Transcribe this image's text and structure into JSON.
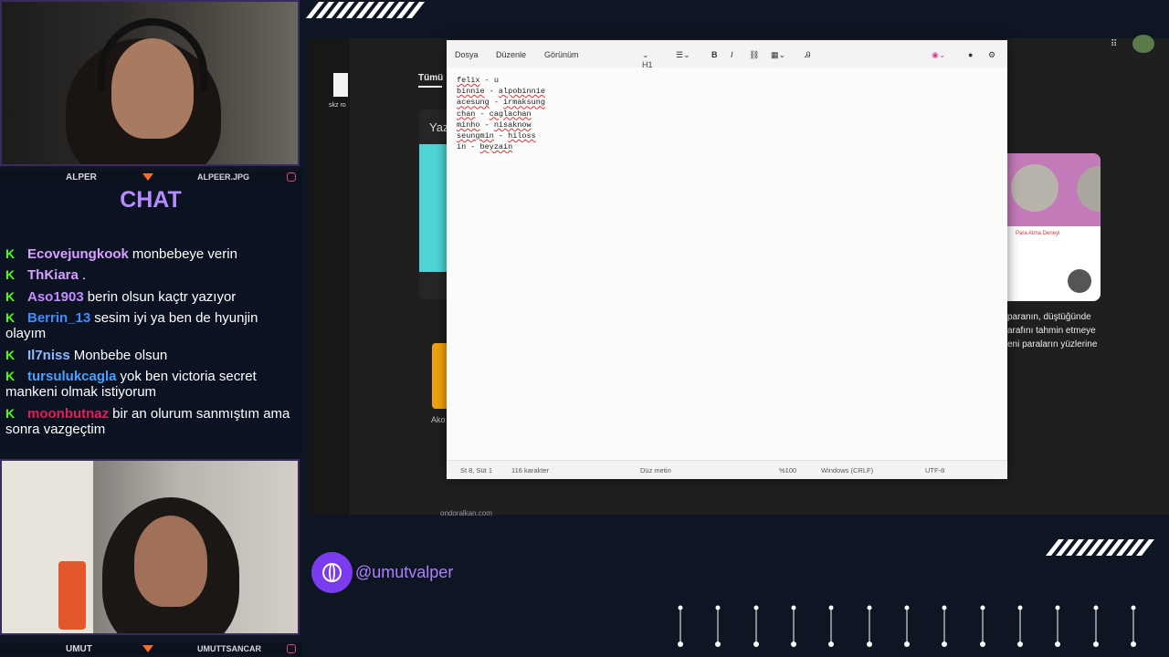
{
  "cams": {
    "top_left_label": "ALPER",
    "top_right_label": "ALPEER.JPG",
    "bottom_left_label": "UMUT",
    "bottom_right_label": "UMUTTSANCAR"
  },
  "chat": {
    "title": "CHAT",
    "messages": [
      {
        "user": "Ecovejungkook",
        "text": "monbebeye verin",
        "color": "#d8a0ff"
      },
      {
        "user": "ThKiara",
        "text": ".",
        "color": "#d8a0ff"
      },
      {
        "user": "Aso1903",
        "text": "berin olsun kaçtr yazıyor",
        "color": "#c58cff"
      },
      {
        "user": "Berrin_13",
        "text": "sesim iyi ya ben de hyunjin olayım",
        "color": "#3f8cff"
      },
      {
        "user": "Il7niss",
        "text": "Monbebe olsun",
        "color": "#8fb8ff"
      },
      {
        "user": "tursulukcagla",
        "text": "yok ben victoria secret mankeni olmak istiyorum",
        "color": "#4aa0ff"
      },
      {
        "user": "moonbutnaz",
        "text": "bir an olurum sanmıştım ama sonra vazgeçtim",
        "color": "#e0205a"
      }
    ]
  },
  "desktop": {
    "file_label": "skz ro",
    "browser_tab": "Tümü",
    "browser_side_text": "Yaz",
    "browser_footer_link": "ondoralkan.com",
    "bottom_card_label": "Ako",
    "article_caption": "Para Atma Deneyi",
    "article_lines": [
      "paranın, düştüğünde",
      "arafını tahmin etmeye",
      "eni paraların yüzlerine"
    ]
  },
  "notepad": {
    "menu": [
      "Dosya",
      "Düzenle",
      "Görünüm"
    ],
    "heading_select": "H1",
    "lines": [
      {
        "name": "felix",
        "value": "u"
      },
      {
        "name": "binnie",
        "value": "alpobinnie"
      },
      {
        "name": "acesung",
        "value": "irmaksung"
      },
      {
        "name": "chan",
        "value": "caglachan"
      },
      {
        "name": "minho",
        "value": "nisaknow"
      },
      {
        "name": "seungmin",
        "value": "hiloss"
      },
      {
        "name": "in",
        "value": "beyzain"
      }
    ],
    "status": {
      "position": "St 8, Süt 1",
      "chars": "116 karakter",
      "format": "Düz metin",
      "zoom": "%100",
      "line_endings": "Windows (CRLF)",
      "encoding": "UTF-8"
    }
  },
  "social": {
    "handle": "@umutvalper"
  },
  "colors": {
    "accent": "#7b3cf0",
    "chat_title": "#b48cff",
    "kick_green": "#53fc18",
    "background": "#0e1624"
  }
}
